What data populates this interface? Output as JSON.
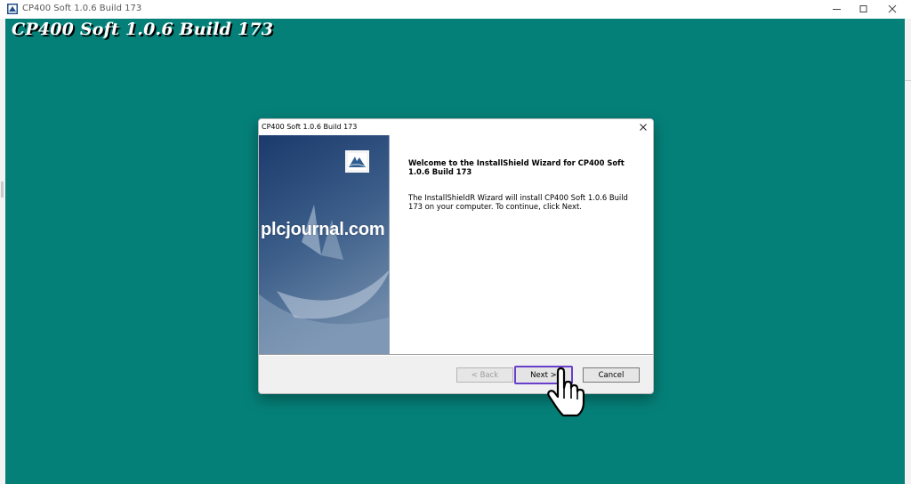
{
  "window": {
    "title": "CP400 Soft 1.0.6 Build 173",
    "controls": [
      "minimize-icon",
      "maximize-icon",
      "close-icon"
    ]
  },
  "installer": {
    "banner_title": "CP400 Soft 1.0.6 Build 173",
    "background_color": "#058079"
  },
  "dialog": {
    "title": "CP400 Soft 1.0.6 Build 173",
    "watermark": "plcjournal.com",
    "welcome_text": "Welcome to the InstallShield Wizard for CP400 Soft 1.0.6 Build 173",
    "description": "The InstallShieldR Wizard will install CP400 Soft 1.0.6 Build 173 on your computer.  To continue, click Next.",
    "buttons": {
      "back": "< Back",
      "next": "Next >",
      "cancel": "Cancel"
    },
    "highlight_color": "#6a3fcc"
  }
}
